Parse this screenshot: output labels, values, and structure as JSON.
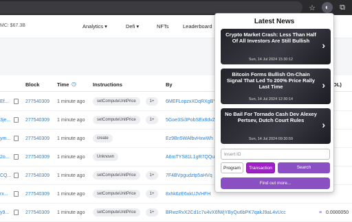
{
  "popup": {
    "title": "Latest News",
    "news": [
      {
        "title": "Crypto Market Crash: Less Than Half Of All Investors Are Still Bullish",
        "date": "Sun, 14 Jul 2024 15:30:12"
      },
      {
        "title": "Bitcoin Forms Bullish On-Chain Signal That Led To 200% Price Rally Last Time",
        "date": "Sun, 14 Jul 2024 12:30:14"
      },
      {
        "title": "No Bail For Tornado Cash Dev Alexey Pertsev, Dutch Court Rules",
        "date": "Sun, 14 Jul 2024 09:30:59"
      }
    ],
    "id_placeholder": "Insert ID",
    "program_label": "Program",
    "transaction_label": "Transaction",
    "search_label": "Search",
    "find_more_label": "Find out more..."
  },
  "site": {
    "market_cap": "MC: $67.3B",
    "nav": [
      "Analytics ▾",
      "Defi ▾",
      "NFTs",
      "Leaderboard"
    ]
  },
  "table": {
    "headers": [
      "Block",
      "Time",
      "Instructions",
      "By",
      "OL)"
    ],
    "rows": [
      {
        "sig": "Ef...",
        "block": "277540309",
        "time": "1 minute ago",
        "instr": "setComputeUnitPrice",
        "more": "1+",
        "by": "6MEFLopzxXDqRXgBY"
      },
      {
        "sig": "3je...",
        "block": "277540309",
        "time": "1 minute ago",
        "instr": "setComputeUnitPrice",
        "more": "1+",
        "by": "5Goe3Si3PobSEx8dvZ"
      },
      {
        "sig": "ym...",
        "block": "277540309",
        "time": "1 minute ago",
        "instr": "create",
        "more": "",
        "by": "Ez9Bn5WAfbvHxwWh"
      },
      {
        "sig": "2o...",
        "block": "277540309",
        "time": "1 minute ago",
        "instr": "Unknown",
        "more": "",
        "by": "A6mTYS81L1gR7QQu"
      },
      {
        "sig": "CQ...",
        "block": "277540309",
        "time": "1 minute ago",
        "instr": "setComputeUnitPrice",
        "more": "1+",
        "by": "7F4BVpgudztp5aHVq"
      },
      {
        "sig": "rx...",
        "block": "277540309",
        "time": "1 minute ago",
        "instr": "setComputeUnitPrice",
        "more": "1+",
        "by": "8xhk6zE6xkUJVHFH"
      },
      {
        "sig": "y9...",
        "block": "277540309",
        "time": "1 minute ago",
        "instr": "setComputeUnitPrice",
        "more": "1+",
        "by": "BRwzRvX2Cd1c7u4vX6fWjYByQu6bPK7qakJ9aL4vUcc",
        "amount": "0.0000050"
      }
    ]
  }
}
